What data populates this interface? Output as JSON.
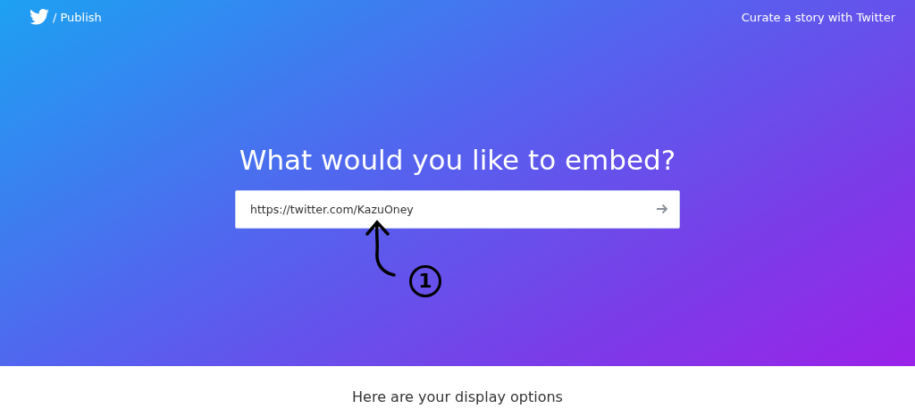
{
  "header": {
    "breadcrumb": "/ Publish",
    "link": "Curate a story with Twitter"
  },
  "hero": {
    "title": "What would you like to embed?",
    "url_field": {
      "value": "https://twitter.com/KazuOney"
    },
    "annotation": {
      "label": "1"
    }
  },
  "options": {
    "heading": "Here are your display options"
  }
}
